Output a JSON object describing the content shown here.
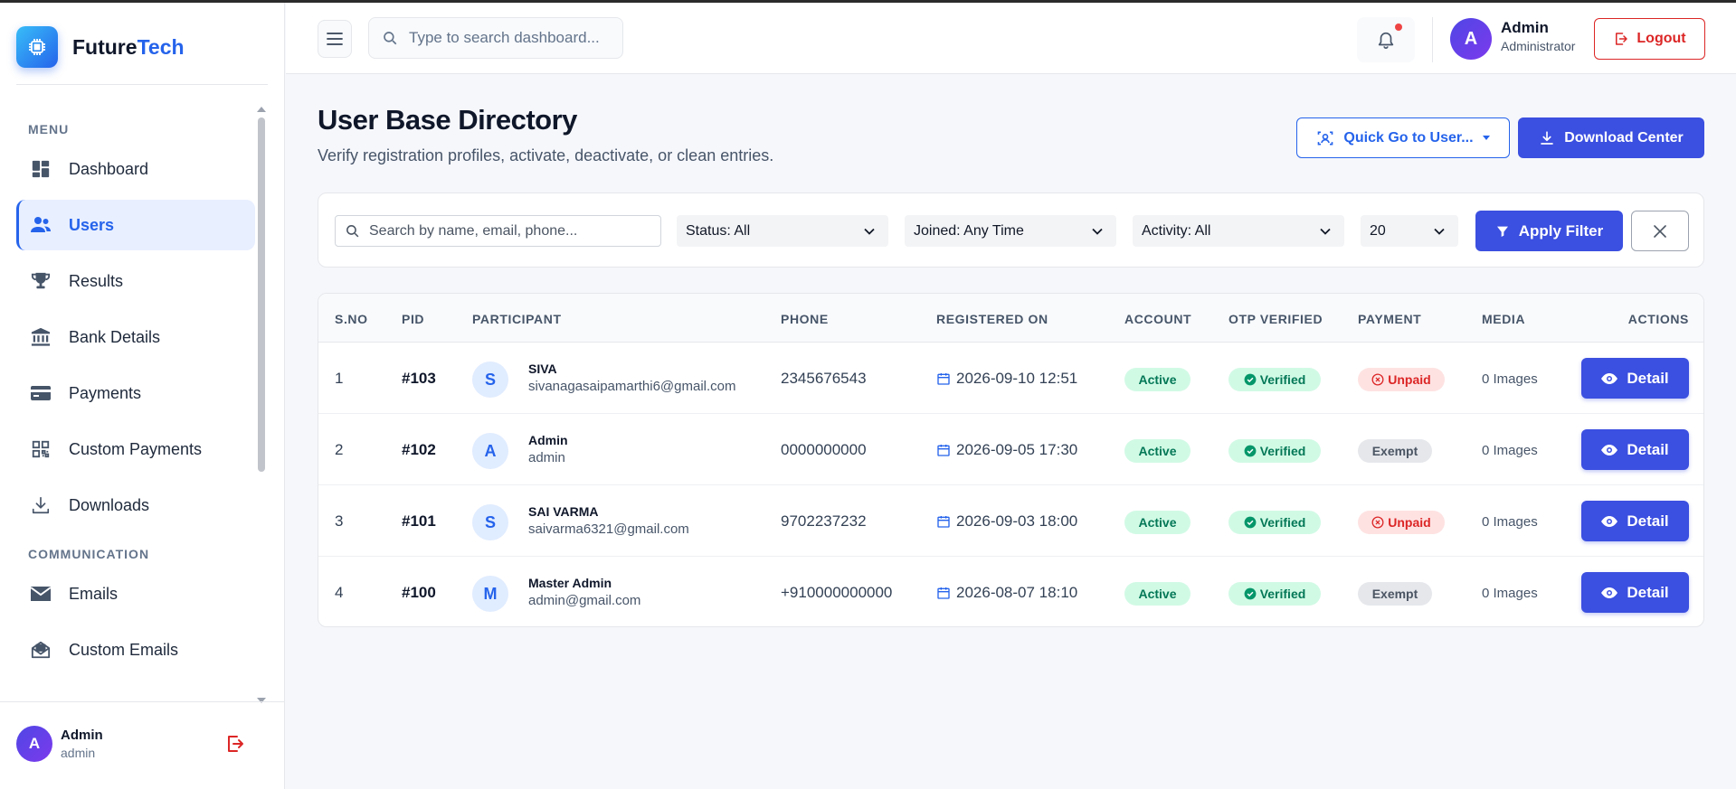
{
  "brand": {
    "name_main": "Future",
    "name_accent": "Tech"
  },
  "sidebar": {
    "sections": [
      {
        "title": "MENU",
        "items": [
          {
            "label": "Dashboard",
            "icon": "dashboard-icon",
            "active": false
          },
          {
            "label": "Users",
            "icon": "users-icon",
            "active": true
          },
          {
            "label": "Results",
            "icon": "trophy-icon",
            "active": false
          },
          {
            "label": "Bank Details",
            "icon": "bank-icon",
            "active": false
          },
          {
            "label": "Payments",
            "icon": "credit-card-icon",
            "active": false
          },
          {
            "label": "Custom Payments",
            "icon": "qr-code-icon",
            "active": false
          },
          {
            "label": "Downloads",
            "icon": "download-icon",
            "active": false
          }
        ]
      },
      {
        "title": "COMMUNICATION",
        "items": [
          {
            "label": "Emails",
            "icon": "envelope-icon",
            "active": false
          },
          {
            "label": "Custom Emails",
            "icon": "envelope-open-icon",
            "active": false
          }
        ]
      }
    ],
    "user": {
      "initial": "A",
      "name": "Admin",
      "role": "admin"
    }
  },
  "header": {
    "search_placeholder": "Type to search dashboard...",
    "user": {
      "initial": "A",
      "name": "Admin",
      "role": "Administrator"
    },
    "logout_label": "Logout"
  },
  "page": {
    "title": "User Base Directory",
    "subtitle": "Verify registration profiles, activate, deactivate, or clean entries.",
    "quick_go_label": "Quick Go to User...",
    "download_label": "Download Center"
  },
  "filters": {
    "search_placeholder": "Search by name, email, phone...",
    "status": "Status: All",
    "joined": "Joined: Any Time",
    "activity": "Activity: All",
    "per_page": "20",
    "apply_label": "Apply Filter"
  },
  "table": {
    "columns": [
      "S.NO",
      "PID",
      "PARTICIPANT",
      "PHONE",
      "REGISTERED ON",
      "ACCOUNT",
      "OTP VERIFIED",
      "PAYMENT",
      "MEDIA",
      "ACTIONS"
    ],
    "rows": [
      {
        "sno": "1",
        "pid": "#103",
        "initial": "S",
        "name": "SIVA",
        "email": "sivanagasaipamarthi6@gmail.com",
        "phone": "2345676543",
        "registered": "2026-09-10 12:51",
        "account": "Active",
        "otp": "Verified",
        "payment": "Unpaid",
        "media": "0 Images",
        "action": "Detail"
      },
      {
        "sno": "2",
        "pid": "#102",
        "initial": "A",
        "name": "Admin",
        "email": "admin",
        "phone": "0000000000",
        "registered": "2026-09-05 17:30",
        "account": "Active",
        "otp": "Verified",
        "payment": "Exempt",
        "media": "0 Images",
        "action": "Detail"
      },
      {
        "sno": "3",
        "pid": "#101",
        "initial": "S",
        "name": "SAI VARMA",
        "email": "saivarma6321@gmail.com",
        "phone": "9702237232",
        "registered": "2026-09-03 18:00",
        "account": "Active",
        "otp": "Verified",
        "payment": "Unpaid",
        "media": "0 Images",
        "action": "Detail"
      },
      {
        "sno": "4",
        "pid": "#100",
        "initial": "M",
        "name": "Master Admin",
        "email": "admin@gmail.com",
        "phone": "+910000000000",
        "registered": "2026-08-07 18:10",
        "account": "Active",
        "otp": "Verified",
        "payment": "Exempt",
        "media": "0 Images",
        "action": "Detail"
      }
    ]
  },
  "colors": {
    "primary": "#3b4fe0",
    "accent": "#2563eb",
    "danger": "#dc2626",
    "success": "#047857"
  }
}
